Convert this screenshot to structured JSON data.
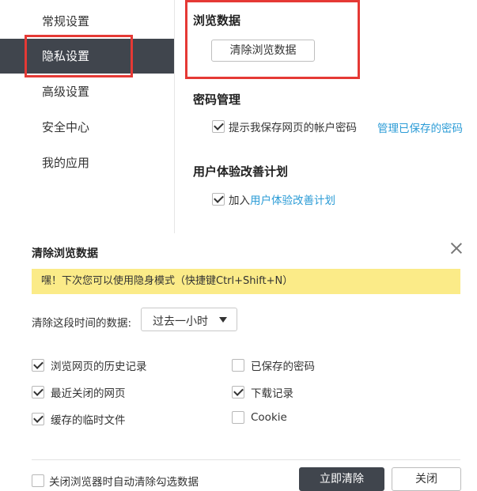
{
  "colors": {
    "sidebar_active_bg": "#40454d",
    "highlight_border": "#e53935",
    "link": "#2a9bd6",
    "notice_bg": "#fbeb88",
    "primary_button_bg": "#40454d"
  },
  "sidebar": {
    "items": [
      {
        "label": "常规设置",
        "active": false
      },
      {
        "label": "隐私设置",
        "active": true
      },
      {
        "label": "高级设置",
        "active": false
      },
      {
        "label": "安全中心",
        "active": false
      },
      {
        "label": "我的应用",
        "active": false
      }
    ]
  },
  "browsing": {
    "title": "浏览数据",
    "clear_button": "清除浏览数据"
  },
  "password": {
    "title": "密码管理",
    "offer_save_label": "提示我保存网页的帐户密码",
    "offer_save_checked": true,
    "manage_link": "管理已保存的密码"
  },
  "ux_plan": {
    "title": "用户体验改善计划",
    "join_prefix": "加入",
    "join_link": "用户体验改善计划",
    "join_checked": true
  },
  "dialog": {
    "title": "清除浏览数据",
    "notice": "嘿！下次您可以使用隐身模式（快捷键Ctrl+Shift+N）",
    "range_label": "清除这段时间的数据:",
    "range_value": "过去一小时",
    "options": [
      {
        "label": "浏览网页的历史记录",
        "checked": true
      },
      {
        "label": "已保存的密码",
        "checked": false
      },
      {
        "label": "最近关闭的网页",
        "checked": true
      },
      {
        "label": "下载记录",
        "checked": true
      },
      {
        "label": "缓存的临时文件",
        "checked": true
      },
      {
        "label": "Cookie",
        "checked": false
      }
    ],
    "auto_clear_label": "关闭浏览器时自动清除勾选数据",
    "auto_clear_checked": false,
    "clear_now_button": "立即清除",
    "close_button": "关闭"
  }
}
